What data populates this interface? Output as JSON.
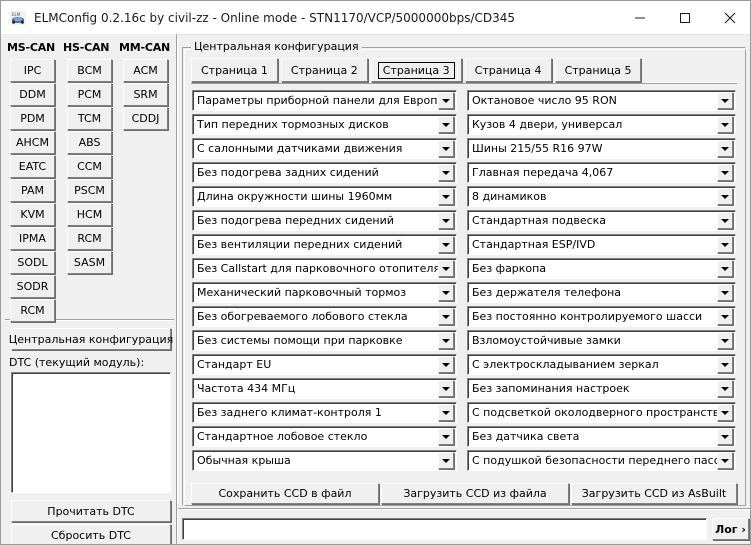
{
  "window": {
    "title": "ELMConfig 0.2.16c by civil-zz - Online mode - STN1170/VCP/5000000bps/CD345",
    "icon": "elmconfig-logo-icon",
    "minimize_label": "—",
    "maximize_label": "□",
    "close_label": "✕"
  },
  "sidebar": {
    "columns": [
      {
        "header": "MS-CAN",
        "buttons": [
          "IPC",
          "DDM",
          "PDM",
          "AHCM",
          "EATC",
          "PAM",
          "KVM",
          "IPMA",
          "SODL",
          "SODR",
          "RCM"
        ]
      },
      {
        "header": "HS-CAN",
        "buttons": [
          "BCM",
          "PCM",
          "TCM",
          "ABS",
          "CCM",
          "PSCM",
          "HCM",
          "RCM",
          "SASM"
        ]
      },
      {
        "header": "MM-CAN",
        "buttons": [
          "ACM",
          "SRM",
          "CDDJ"
        ]
      }
    ],
    "central_config_label": "Центральная конфигурация",
    "dtc_label": "DTC (текущий модуль):",
    "dtc_list_value": "",
    "read_dtc_label": "Прочитать DTC",
    "reset_dtc_label": "Сбросить DTC"
  },
  "main": {
    "group_title": "Центральная конфигурация",
    "tabs": [
      {
        "label": "Страница 1",
        "selected": false
      },
      {
        "label": "Страница 2",
        "selected": false
      },
      {
        "label": "Страница 3",
        "selected": true
      },
      {
        "label": "Страница 4",
        "selected": false
      },
      {
        "label": "Страница 5",
        "selected": false
      }
    ],
    "left_column": [
      "Параметры приборной панели для Европы",
      "Тип передних тормозных дисков",
      "С салонными датчиками движения",
      "Без подогрева задних сидений",
      "Длина окружности шины 1960мм",
      "Без подогрева передних сидений",
      "Без вентиляции передних сидений",
      "Без Callstart для парковочного отопителя",
      "Механический парковочный тормоз",
      "Без обогреваемого лобового стекла",
      "Без системы помощи при парковке",
      "Стандарт EU",
      "Частота 434 МГц",
      "Без заднего климат-контроля 1",
      "Стандартное лобовое стекло",
      "Обычная крыша"
    ],
    "right_column": [
      "Октановое число 95 RON",
      "Кузов 4 двери, универсал",
      "Шины 215/55 R16 97W",
      "Главная передача 4,067",
      "8 динамиков",
      "Стандартная подвеска",
      "Стандартная ESP/IVD",
      "Без фаркопа",
      "Без держателя телефона",
      "Без постоянно контролируемого шасси",
      "Взломоустойчивые замки",
      "С электроскладыванием зеркал",
      "Без запоминания настроек",
      "С подсветкой околодверного пространства",
      "Без датчика света",
      "С подушкой безопасности переднего пассажира"
    ],
    "actions": [
      "Сохранить CCD в файл",
      "Загрузить CCD из файла",
      "Загрузить CCD из AsBuilt"
    ]
  },
  "bottom": {
    "log_input_value": "",
    "log_input_placeholder": "",
    "log_button_label": "Лог ›"
  },
  "colors": {
    "window_bg": "#f0f0f0",
    "titlebar_bg": "#ffffff",
    "field_bg": "#ffffff",
    "text": "#000000",
    "shadow": "#808080",
    "highlight": "#ffffff"
  }
}
